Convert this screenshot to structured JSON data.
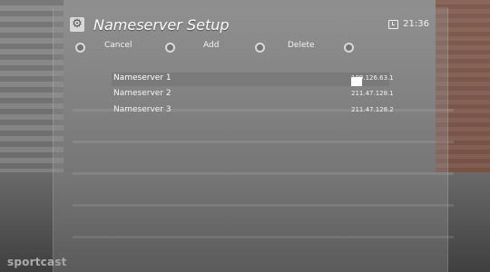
{
  "watermark": "sportcast",
  "header": {
    "title": "Nameserver Setup",
    "time": "21:36",
    "icon": "gear-icon",
    "clock_icon": "clock-icon"
  },
  "buttons": [
    {
      "label": "Cancel"
    },
    {
      "label": "Add"
    },
    {
      "label": "Delete"
    }
  ],
  "nameservers": [
    {
      "label": "Nameserver 1",
      "value": "109.126.63.1",
      "selected": true
    },
    {
      "label": "Nameserver 2",
      "value": "211.47.128.1",
      "selected": false
    },
    {
      "label": "Nameserver 3",
      "value": "211.47.128.2",
      "selected": false
    }
  ],
  "colors": {
    "panel": "#969696",
    "selected_row": "#7a7a7a",
    "text": "#f2f2f2"
  }
}
